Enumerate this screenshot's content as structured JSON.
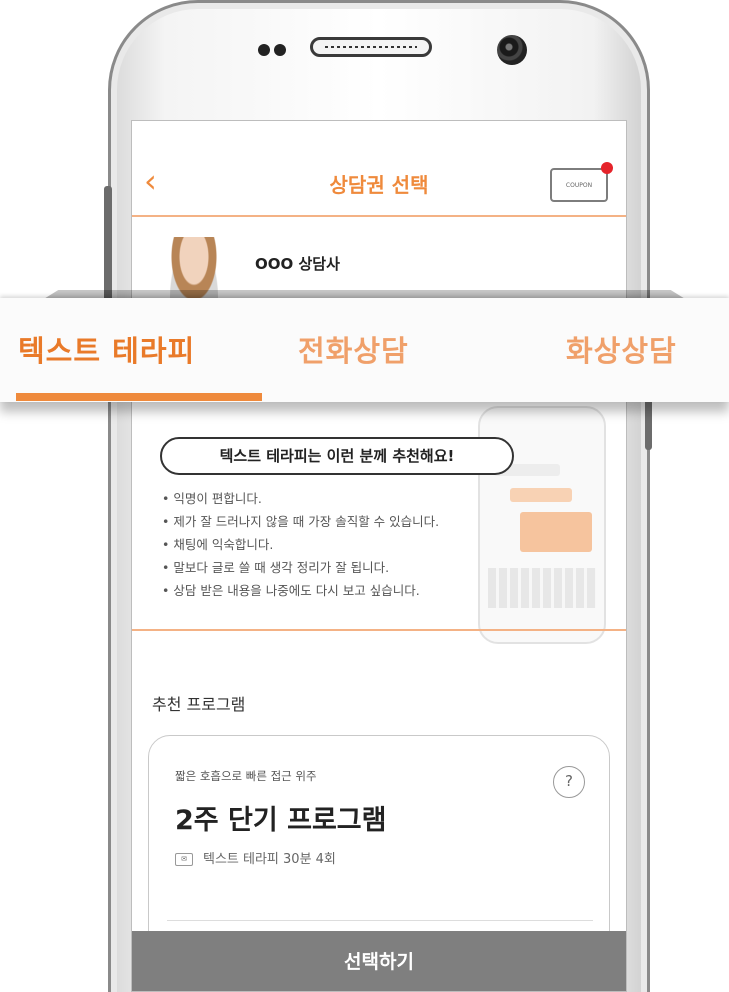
{
  "header": {
    "title": "상담권 선택",
    "back_icon": "chevron-left-icon",
    "coupon_label": "COUPON"
  },
  "counselor": {
    "name": "OOO 상담사"
  },
  "tabs": [
    {
      "label": "텍스트 테라피",
      "active": true
    },
    {
      "label": "전화상담",
      "active": false
    },
    {
      "label": "화상상담",
      "active": false
    }
  ],
  "recommend": {
    "heading": "텍스트 테라피는 이런 분께 추천해요!",
    "items": [
      "익명이 편합니다.",
      "제가 잘 드러나지 않을 때 가장 솔직할 수 있습니다.",
      "채팅에 익숙합니다.",
      "말보다 글로 쓸 때 생각 정리가 잘 됩니다.",
      "상담 받은 내용을 나중에도 다시 보고 싶습니다."
    ]
  },
  "program": {
    "section_title": "추천 프로그램",
    "subtitle": "짧은 호흡으로 빠른 접근 위주",
    "title": "2주 단기 프로그램",
    "detail": "텍스트 테라피 30분 4회",
    "help_label": "?"
  },
  "footer": {
    "select_label": "선택하기"
  },
  "colors": {
    "accent": "#ef8a3c",
    "accent_light": "#f4b285",
    "button_gray": "#7f7f7f",
    "notification": "#e5232a"
  }
}
